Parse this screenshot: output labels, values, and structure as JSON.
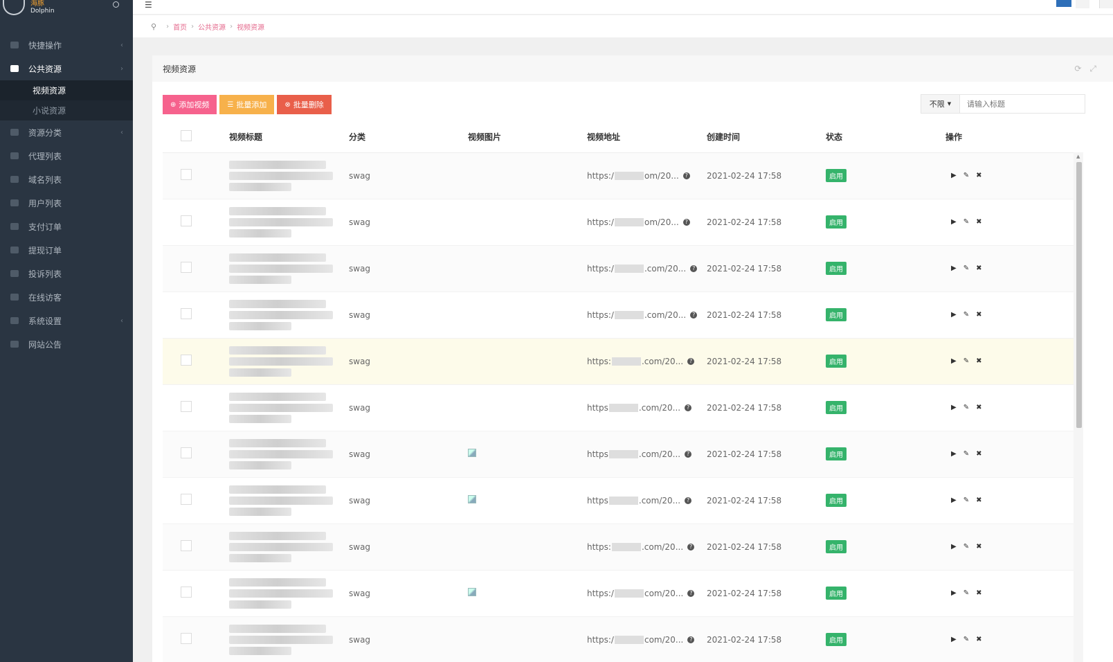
{
  "brand": {
    "line1": "海豚",
    "line2": "Dolphin"
  },
  "sidebar": {
    "items": [
      {
        "label": "快捷操作",
        "chevron": "‹"
      },
      {
        "label": "公共资源",
        "chevron": "›",
        "active": true,
        "children": [
          {
            "label": "视频资源",
            "active": true
          },
          {
            "label": "小说资源"
          }
        ]
      },
      {
        "label": "资源分类",
        "chevron": "‹"
      },
      {
        "label": "代理列表"
      },
      {
        "label": "域名列表"
      },
      {
        "label": "用户列表"
      },
      {
        "label": "支付订单"
      },
      {
        "label": "提现订单"
      },
      {
        "label": "投诉列表"
      },
      {
        "label": "在线访客"
      },
      {
        "label": "系统设置",
        "chevron": "‹"
      },
      {
        "label": "网站公告"
      }
    ]
  },
  "breadcrumb": [
    "首页",
    "公共资源",
    "视频资源"
  ],
  "panel": {
    "title": "视频资源"
  },
  "toolbar": {
    "add": "添加视频",
    "batch_add": "批量添加",
    "batch_delete": "批量删除"
  },
  "search": {
    "select_value": "不限",
    "placeholder": "请输入标题"
  },
  "table": {
    "headers": [
      "视频标题",
      "分类",
      "视频图片",
      "视频地址",
      "创建时间",
      "状态",
      "操作"
    ],
    "rows": [
      {
        "category": "swag",
        "url_a": "https:/",
        "url_b": "om/20...",
        "time": "2021-02-24 17:58",
        "status": "启用",
        "img": false
      },
      {
        "category": "swag",
        "url_a": "https:/",
        "url_b": "om/20...",
        "time": "2021-02-24 17:58",
        "status": "启用",
        "img": false
      },
      {
        "category": "swag",
        "url_a": "https:/",
        "url_b": ".com/20...",
        "time": "2021-02-24 17:58",
        "status": "启用",
        "img": false
      },
      {
        "category": "swag",
        "url_a": "https:/",
        "url_b": ".com/20...",
        "time": "2021-02-24 17:58",
        "status": "启用",
        "img": false
      },
      {
        "category": "swag",
        "url_a": "https:",
        "url_b": ".com/20...",
        "time": "2021-02-24 17:58",
        "status": "启用",
        "img": false
      },
      {
        "category": "swag",
        "url_a": "https",
        "url_b": ".com/20...",
        "time": "2021-02-24 17:58",
        "status": "启用",
        "img": false
      },
      {
        "category": "swag",
        "url_a": "https",
        "url_b": ".com/20...",
        "time": "2021-02-24 17:58",
        "status": "启用",
        "img": true
      },
      {
        "category": "swag",
        "url_a": "https",
        "url_b": ".com/20...",
        "time": "2021-02-24 17:58",
        "status": "启用",
        "img": true
      },
      {
        "category": "swag",
        "url_a": "https:",
        "url_b": ".com/20...",
        "time": "2021-02-24 17:58",
        "status": "启用",
        "img": false
      },
      {
        "category": "swag",
        "url_a": "https:/",
        "url_b": "com/20...",
        "time": "2021-02-24 17:58",
        "status": "启用",
        "img": true
      },
      {
        "category": "swag",
        "url_a": "https:/",
        "url_b": "com/20...",
        "time": "2021-02-24 17:58",
        "status": "启用",
        "img": false
      }
    ],
    "highlight_row": 4,
    "ops_icons": [
      "play-icon",
      "edit-icon",
      "delete-icon"
    ]
  },
  "colors": {
    "sidebar": "#2a3542",
    "pink": "#f6628d",
    "orange": "#f7b14b",
    "red": "#e95f4a",
    "status": "#35b36b"
  }
}
